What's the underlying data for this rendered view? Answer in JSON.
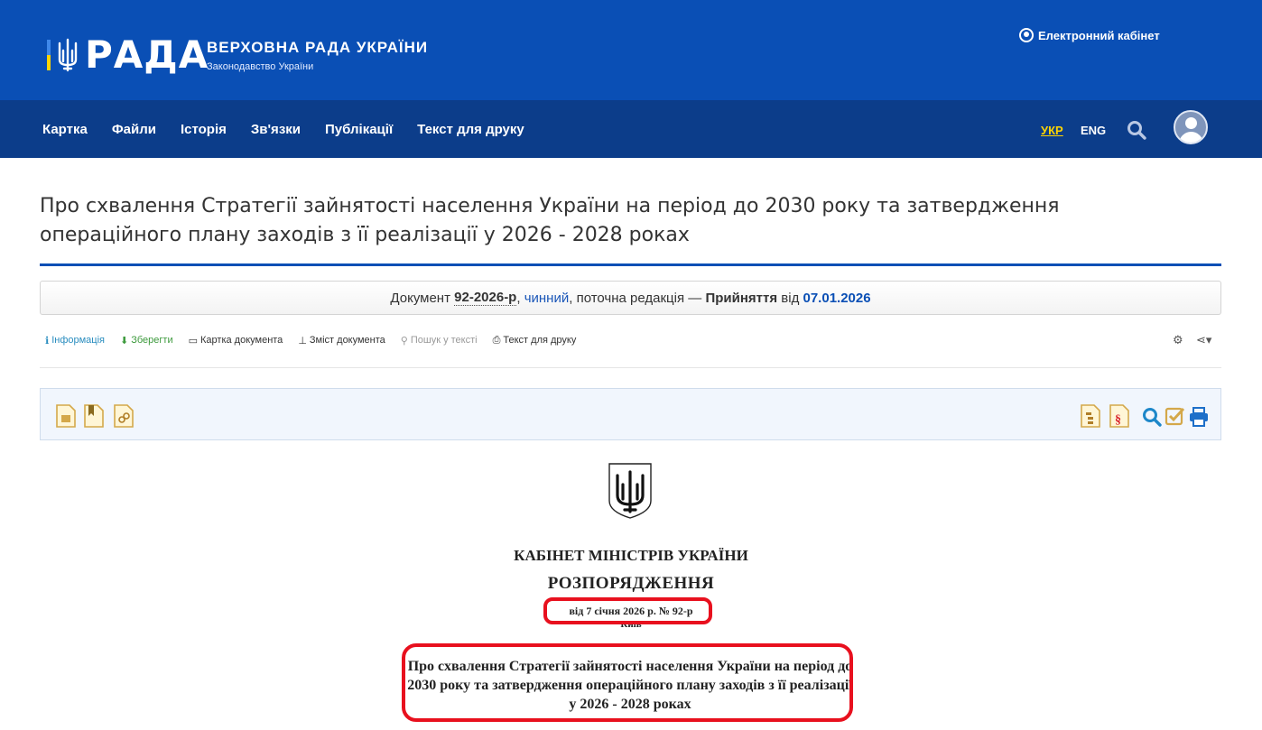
{
  "header": {
    "logo_word": "РАДА",
    "org_title": "ВЕРХОВНА РАДА УКРАЇНИ",
    "org_subtitle": "Законодавство України",
    "cabinet_link": "Електронний кабінет",
    "brand_colors": {
      "header_blue": "#0a4fb5",
      "nav_blue": "#0c3d8a",
      "accent_yellow": "#ffd500"
    }
  },
  "nav": {
    "items": [
      {
        "label": "Картка"
      },
      {
        "label": "Файли"
      },
      {
        "label": "Історія"
      },
      {
        "label": "Зв'язки"
      },
      {
        "label": "Публікації"
      },
      {
        "label": "Текст для друку"
      }
    ],
    "lang_ukr": "УКР",
    "lang_eng": "ENG",
    "icons": [
      "search-icon",
      "user-avatar-icon"
    ]
  },
  "document": {
    "title": "Про схвалення Стратегії зайнятості населення України на період до 2030 року та затвердження операційного плану заходів з її реалізації у 2026 - 2028 роках",
    "status": {
      "prefix": "Документ",
      "number": "92-2026-р",
      "state": "чинний",
      "middle": ", поточна редакція —",
      "action": "Прийняття",
      "from": "від",
      "date": "07.01.2026"
    }
  },
  "toolbar": {
    "items": [
      {
        "label": "Інформація",
        "icon": "info-icon"
      },
      {
        "label": "Зберегти",
        "icon": "download-icon"
      },
      {
        "label": "Картка документа",
        "icon": "folder-icon"
      },
      {
        "label": "Зміст документа",
        "icon": "sitemap-icon"
      },
      {
        "label": "Пошук у тексті",
        "icon": "search-icon"
      },
      {
        "label": "Текст для друку",
        "icon": "print-icon"
      }
    ]
  },
  "doc_body": {
    "issuer": "КАБІНЕТ МІНІСТРІВ УКРАЇНИ",
    "kind": "РОЗПОРЯДЖЕННЯ",
    "date_line": "від 7 січня 2026 р. № 92-р",
    "city": "Київ",
    "heading": "Про схвалення Стратегії зайнятості населення України на період до 2030 року та затвердження операційного плану заходів з її реалізації у 2026 - 2028 роках",
    "highlight_color": "#e8101e"
  }
}
